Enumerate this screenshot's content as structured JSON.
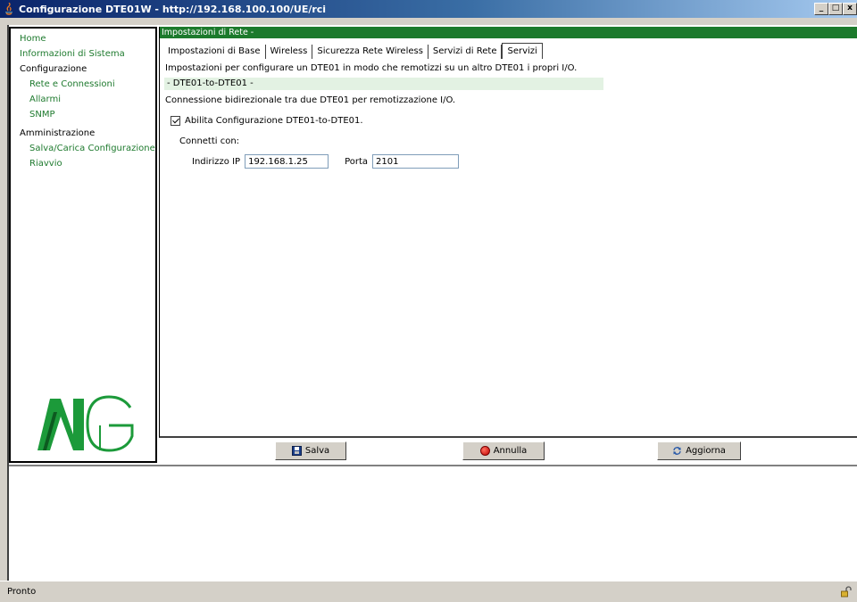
{
  "window": {
    "title": "Configurazione DTE01W - http://192.168.100.100/UE/rci",
    "minimize": "_",
    "maximize": "□",
    "close": "x"
  },
  "sidebar": {
    "items": [
      {
        "label": "Home",
        "type": "link",
        "level": 0
      },
      {
        "label": "Informazioni di Sistema",
        "type": "link",
        "level": 0
      },
      {
        "label": "Configurazione",
        "type": "heading",
        "level": 0
      },
      {
        "label": "Rete e Connessioni",
        "type": "link",
        "level": 1
      },
      {
        "label": "Allarmi",
        "type": "link",
        "level": 1
      },
      {
        "label": "SNMP",
        "type": "link",
        "level": 1
      },
      {
        "label": "Amministrazione",
        "type": "heading",
        "level": 0
      },
      {
        "label": "Salva/Carica Configurazione",
        "type": "link",
        "level": 1
      },
      {
        "label": "Riavvio",
        "type": "link",
        "level": 1
      }
    ],
    "logo_icon": "mg-logo"
  },
  "content": {
    "section_header": "Impostazioni di Rete -",
    "tabs": [
      {
        "label": "Impostazioni di Base",
        "active": false
      },
      {
        "label": "Wireless",
        "active": false
      },
      {
        "label": "Sicurezza Rete Wireless",
        "active": false
      },
      {
        "label": "Servizi di Rete",
        "active": false
      },
      {
        "label": "Servizi",
        "active": true
      }
    ],
    "description": "Impostazioni per configurare un DTE01 in modo che remotizzi su un altro DTE01 i propri I/O.",
    "subsection_title": "- DTE01-to-DTE01 -",
    "subsection_description": "Connessione bidirezionale tra due DTE01 per remotizzazione I/O.",
    "enable_label": "Abilita Configurazione DTE01-to-DTE01.",
    "enable_checked": true,
    "connect_label": "Connetti con:",
    "ip_label": "Indirizzo IP",
    "ip_value": "192.168.1.25",
    "port_label": "Porta",
    "port_value": "2101"
  },
  "buttons": {
    "save": "Salva",
    "cancel": "Annulla",
    "refresh": "Aggiorna"
  },
  "status": {
    "text": "Pronto"
  },
  "colors": {
    "accent_green": "#1c7a2c",
    "link_green": "#1e7a2e",
    "subsection_bg": "#e3f2e3",
    "titlebar_blue": "#0a246a"
  }
}
